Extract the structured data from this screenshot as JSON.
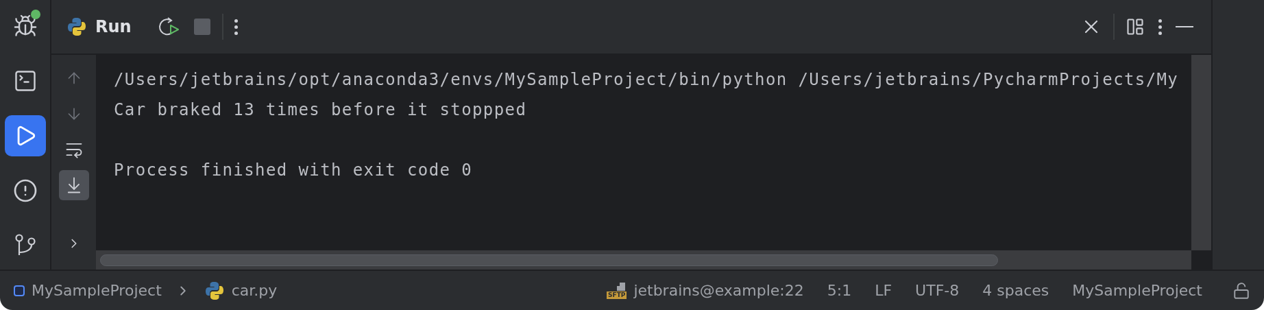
{
  "sidebar": {
    "items": [
      {
        "kind": "debug",
        "selected": false,
        "color": "#5fb865"
      },
      {
        "kind": "terminal",
        "selected": false
      },
      {
        "kind": "run",
        "selected": true
      },
      {
        "kind": "problems",
        "selected": false
      },
      {
        "kind": "git",
        "selected": false
      }
    ]
  },
  "toolbar": {
    "title": "Run"
  },
  "gutter": {
    "tools": [
      {
        "kind": "up",
        "selected": false,
        "disabled": true
      },
      {
        "kind": "down",
        "selected": false,
        "disabled": true
      },
      {
        "kind": "wrap",
        "selected": false,
        "disabled": false
      },
      {
        "kind": "scroll_end",
        "selected": true,
        "disabled": false
      },
      {
        "kind": "more",
        "selected": false,
        "disabled": false
      }
    ]
  },
  "console": {
    "blocks": [
      {
        "lines": [
          "/Users/jetbrains/opt/anaconda3/envs/MySampleProject/bin/python /Users/jetbrains/PycharmProjects/My",
          "Car braked 13 times before it stoppped"
        ]
      },
      {
        "lines": [
          "Process finished with exit code 0"
        ]
      }
    ]
  },
  "status_bar": {
    "breadcrumbs": [
      "MySampleProject",
      "car.py"
    ],
    "sftp_badge": "SFTP",
    "items": [
      "jetbrains@example:22",
      "5:1",
      "LF",
      "UTF-8",
      "4 spaces",
      "MySampleProject"
    ]
  }
}
